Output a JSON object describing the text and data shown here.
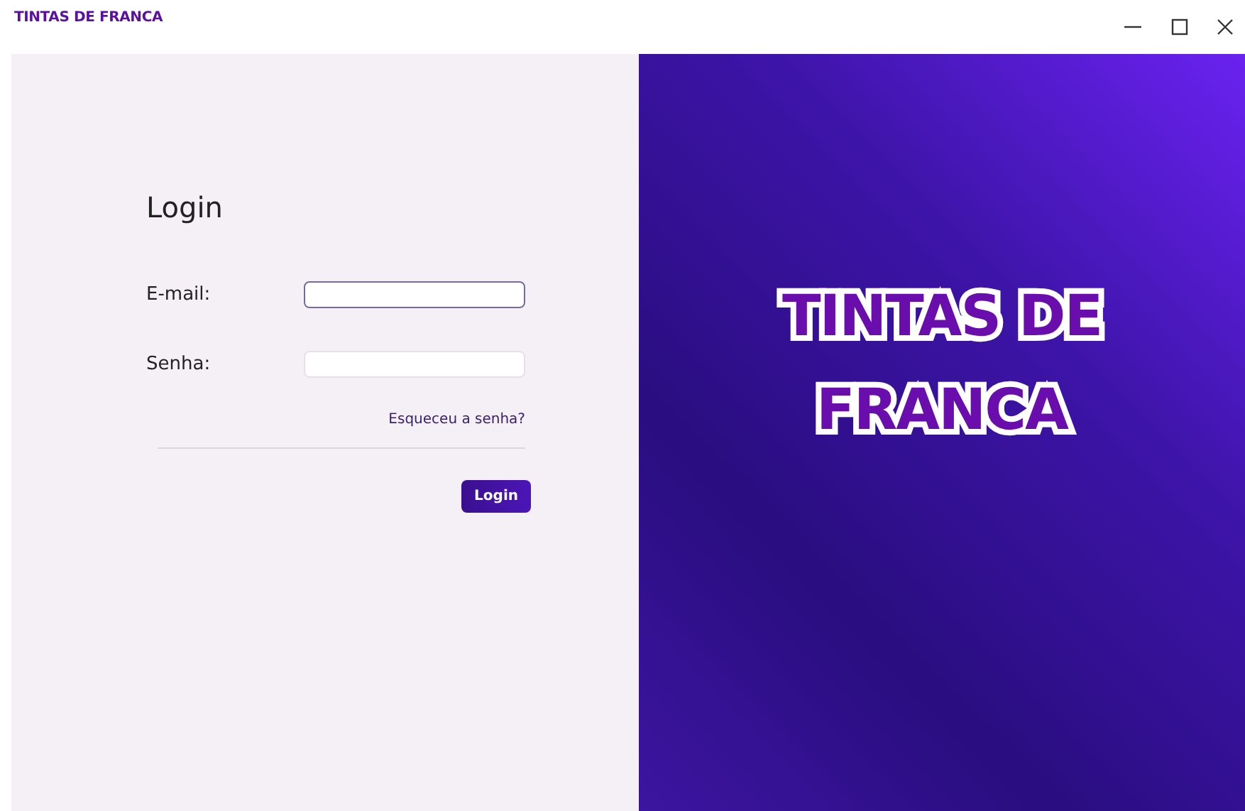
{
  "window": {
    "title": "TINTAS DE FRANCA"
  },
  "login": {
    "heading": "Login",
    "fields": [
      {
        "label": "E-mail:",
        "focused": true
      },
      {
        "label": "Senha:",
        "focused": false
      }
    ],
    "forgot_link": "Esqueceu a senha?",
    "button": "Login"
  },
  "banner": {
    "lines": [
      "TINTAS DE",
      "FRANCA"
    ]
  }
}
